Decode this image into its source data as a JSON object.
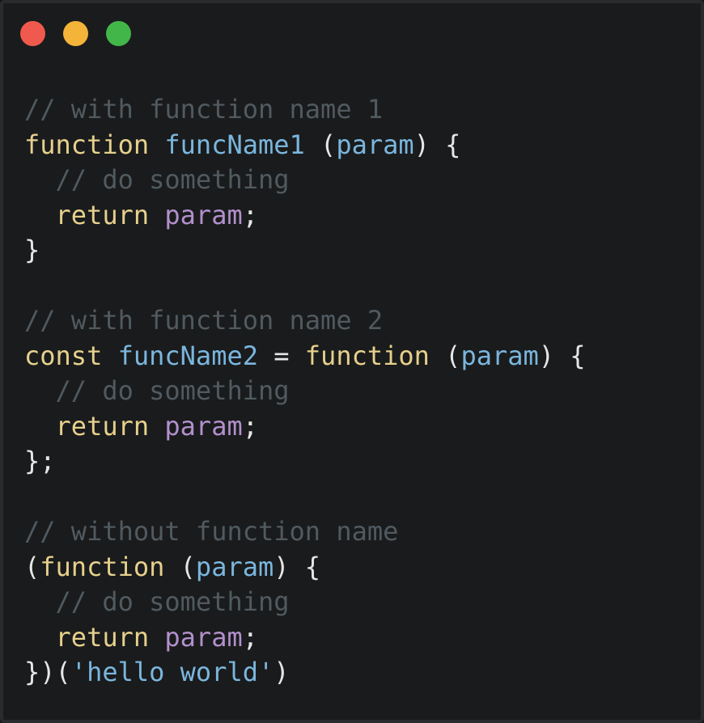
{
  "window": {
    "controls": [
      {
        "name": "close",
        "color": "#f05a4e"
      },
      {
        "name": "minimize",
        "color": "#f4b43a"
      },
      {
        "name": "maximize",
        "color": "#43b64a"
      }
    ]
  },
  "colors": {
    "comment": "#505a60",
    "keyword": "#e6d08c",
    "identifier": "#7ab6de",
    "param_use": "#b290cc",
    "punct": "#e6e6e6",
    "string": "#7ab6de"
  },
  "lines": [
    [
      {
        "t": "// with function name 1",
        "c": "comment"
      }
    ],
    [
      {
        "t": "function",
        "c": "keyword"
      },
      {
        "t": " ",
        "c": "punct"
      },
      {
        "t": "funcName1",
        "c": "identifier"
      },
      {
        "t": " (",
        "c": "punct"
      },
      {
        "t": "param",
        "c": "identifier"
      },
      {
        "t": ") {",
        "c": "punct"
      }
    ],
    [
      {
        "t": "  // do something",
        "c": "comment"
      }
    ],
    [
      {
        "t": "  ",
        "c": "punct"
      },
      {
        "t": "return",
        "c": "keyword"
      },
      {
        "t": " ",
        "c": "punct"
      },
      {
        "t": "param",
        "c": "param_use"
      },
      {
        "t": ";",
        "c": "punct"
      }
    ],
    [
      {
        "t": "}",
        "c": "punct"
      }
    ],
    [],
    [
      {
        "t": "// with function name 2",
        "c": "comment"
      }
    ],
    [
      {
        "t": "const",
        "c": "keyword"
      },
      {
        "t": " ",
        "c": "punct"
      },
      {
        "t": "funcName2",
        "c": "identifier"
      },
      {
        "t": " = ",
        "c": "punct"
      },
      {
        "t": "function",
        "c": "keyword"
      },
      {
        "t": " (",
        "c": "punct"
      },
      {
        "t": "param",
        "c": "identifier"
      },
      {
        "t": ") {",
        "c": "punct"
      }
    ],
    [
      {
        "t": "  // do something",
        "c": "comment"
      }
    ],
    [
      {
        "t": "  ",
        "c": "punct"
      },
      {
        "t": "return",
        "c": "keyword"
      },
      {
        "t": " ",
        "c": "punct"
      },
      {
        "t": "param",
        "c": "param_use"
      },
      {
        "t": ";",
        "c": "punct"
      }
    ],
    [
      {
        "t": "};",
        "c": "punct"
      }
    ],
    [],
    [
      {
        "t": "// without function name",
        "c": "comment"
      }
    ],
    [
      {
        "t": "(",
        "c": "punct"
      },
      {
        "t": "function",
        "c": "keyword"
      },
      {
        "t": " (",
        "c": "punct"
      },
      {
        "t": "param",
        "c": "identifier"
      },
      {
        "t": ") {",
        "c": "punct"
      }
    ],
    [
      {
        "t": "  // do something",
        "c": "comment"
      }
    ],
    [
      {
        "t": "  ",
        "c": "punct"
      },
      {
        "t": "return",
        "c": "keyword"
      },
      {
        "t": " ",
        "c": "punct"
      },
      {
        "t": "param",
        "c": "param_use"
      },
      {
        "t": ";",
        "c": "punct"
      }
    ],
    [
      {
        "t": "})(",
        "c": "punct"
      },
      {
        "t": "'hello world'",
        "c": "string"
      },
      {
        "t": ")",
        "c": "punct"
      }
    ]
  ]
}
